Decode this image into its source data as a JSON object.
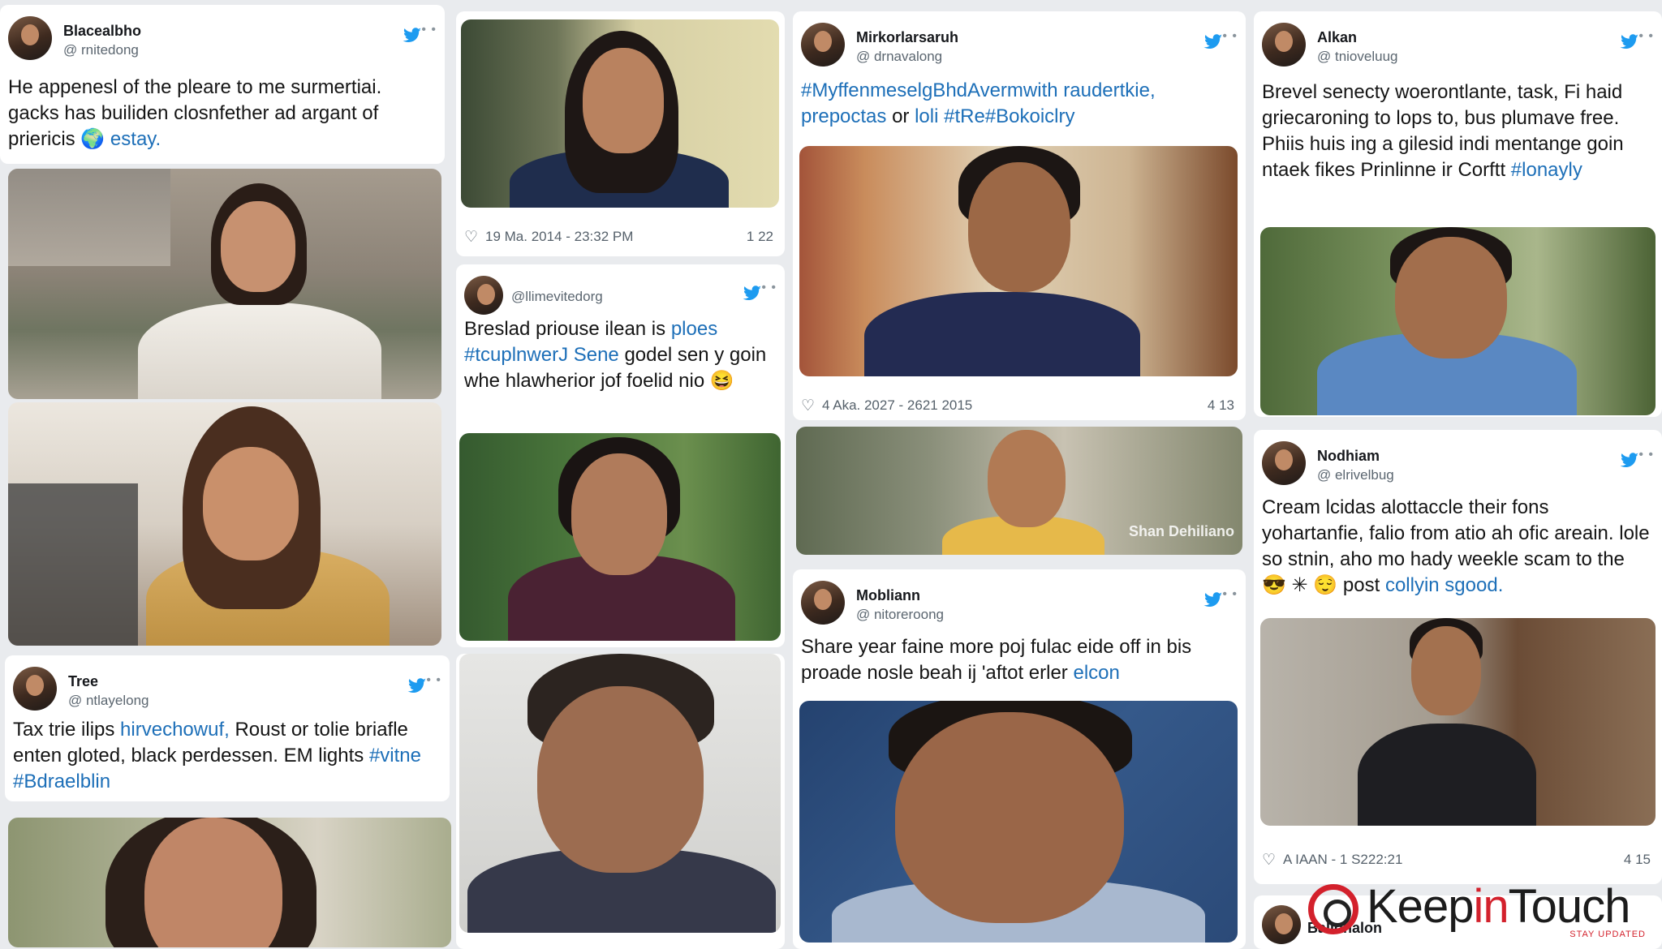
{
  "feed": {
    "cards": [
      {
        "name": "Blacealbho",
        "handle": "@ rnitedong",
        "text": "He appenesl of the pleare to me surmertiai. gacks has builiden closnfether ad argant of priericis",
        "tag": "estay."
      },
      {
        "timestamp": "19 Ma. 2014 - 23:32 PM",
        "count": "1 22"
      },
      {
        "handle": "@llimevitedorg",
        "text_a": "Breslad priouse ilean is",
        "tag": "ploes #tcuplnwerJ Sene",
        "text_b": "godel sen y goin whe hlawherior jof foelid nio"
      },
      {
        "name": "Mirkorlarsaruh",
        "handle": "@ drnavalong",
        "tag_a": "#MyffenmeselgBhdAvermwith raudertkie, prepoctas",
        "text": "or",
        "tag_b": "loli #tRe#Bokoiclry"
      },
      {
        "timestamp": "4 Aka. 2027 - 2621 2015",
        "count": "4 13"
      },
      {
        "overlay": "Shan Dehiliano"
      },
      {
        "name": "Mobliann",
        "handle": "@ nitoreroong",
        "text": "Share year faine more poj fulac eide off in bis proade nosle beah ij 'aftot erler",
        "tag": "elcon"
      },
      {
        "name": "Alkan",
        "handle": "@ tnioveluug",
        "text": "Brevel senecty woerontlante, task, Fi haid griecaroning to lops to, bus plumave free. Phiis huis ing a gilesid indi mentange goin ntaek fikes Prinlinne ir Corftt",
        "tag": "#lonayly"
      },
      {
        "name": "Nodhiam",
        "handle": "@ elrivelbug",
        "text_a": "Cream lcidas alottaccle their fons yohartanfie, falio from atio ah ofic areain. lole so stnin, aho mo hady weekle scam to the",
        "text_b": "post",
        "tag": "collyin sgood."
      },
      {
        "timestamp": "A IAAN - 1 S222:21",
        "count": "4 15"
      },
      {
        "name": "Ballohalon"
      },
      {
        "name": "Tree",
        "handle": "@ ntlayelong",
        "text_a": "Tax trie ilips",
        "tag_a": "hirvechowuf,",
        "text_b": "Roust or tolie briafle enten gloted, black perdessen. EM lights",
        "tag_b": "#vitne #Bdraelblin"
      }
    ]
  },
  "watermark": {
    "brand_a": "Keep",
    "brand_b": "in",
    "brand_c": "Touch",
    "tagline": "STAY UPDATED"
  },
  "colors": {
    "accent_link": "#1d6fb8",
    "twitter_blue": "#1d9bf0",
    "brand_red": "#d3212c"
  }
}
